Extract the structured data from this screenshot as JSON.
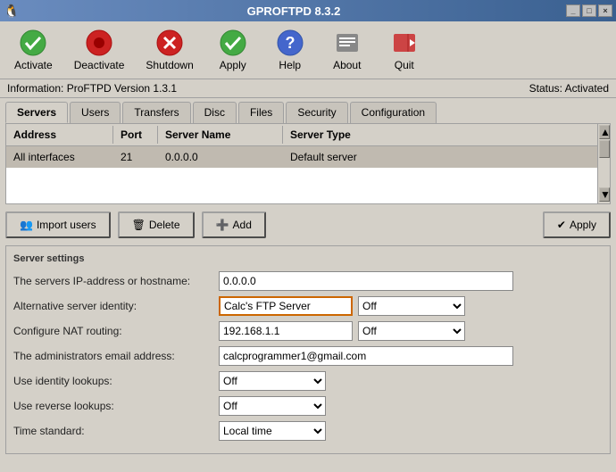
{
  "window": {
    "title": "GPROFTPD 8.3.2"
  },
  "titlebar": {
    "controls": [
      "_",
      "□",
      "×"
    ]
  },
  "toolbar": {
    "items": [
      {
        "id": "activate",
        "label": "Activate",
        "icon": "✔",
        "icon_color": "#44aa44"
      },
      {
        "id": "deactivate",
        "label": "Deactivate",
        "icon": "●",
        "icon_color": "#cc2222"
      },
      {
        "id": "shutdown",
        "label": "Shutdown",
        "icon": "✖",
        "icon_color": "#cc2222"
      },
      {
        "id": "apply",
        "label": "Apply",
        "icon": "✔",
        "icon_color": "#44aa44"
      },
      {
        "id": "help",
        "label": "Help",
        "icon": "?",
        "icon_color": "#4466cc"
      },
      {
        "id": "about",
        "label": "About",
        "icon": "≡",
        "icon_color": "#555555"
      },
      {
        "id": "quit",
        "label": "Quit",
        "icon": "⏻",
        "icon_color": "#cc4444"
      }
    ]
  },
  "statusbar": {
    "left": "Information: ProFTPD Version 1.3.1",
    "right": "Status: Activated"
  },
  "tabs": [
    {
      "id": "servers",
      "label": "Servers",
      "active": true
    },
    {
      "id": "users",
      "label": "Users"
    },
    {
      "id": "transfers",
      "label": "Transfers"
    },
    {
      "id": "disc",
      "label": "Disc"
    },
    {
      "id": "files",
      "label": "Files"
    },
    {
      "id": "security",
      "label": "Security"
    },
    {
      "id": "configuration",
      "label": "Configuration"
    }
  ],
  "table": {
    "columns": [
      "Address",
      "Port",
      "Server Name",
      "Server Type"
    ],
    "rows": [
      {
        "address": "All interfaces",
        "port": "21",
        "server_name": "0.0.0.0",
        "server_type": "Default server"
      }
    ]
  },
  "actions": {
    "import_users": "Import users",
    "delete": "Delete",
    "add": "Add",
    "apply": "Apply"
  },
  "settings": {
    "legend": "Server settings",
    "fields": [
      {
        "label": "The servers IP-address or hostname:",
        "value": "0.0.0.0",
        "type": "input",
        "width": "wide"
      },
      {
        "label": "Alternative server identity:",
        "value": "Calc's FTP Server",
        "type": "input-select",
        "width": "short",
        "highlight": true,
        "select_value": "Off"
      },
      {
        "label": "Configure NAT routing:",
        "value": "192.168.1.1",
        "type": "input-select",
        "width": "short",
        "select_value": "Off"
      },
      {
        "label": "The administrators email address:",
        "value": "calcprogrammer1@gmail.com",
        "type": "input",
        "width": "wide"
      },
      {
        "label": "Use identity lookups:",
        "type": "select-only",
        "select_value": "Off"
      },
      {
        "label": "Use reverse lookups:",
        "type": "select-only",
        "select_value": "Off"
      },
      {
        "label": "Time standard:",
        "type": "select-only",
        "select_value": "Local time"
      }
    ]
  }
}
